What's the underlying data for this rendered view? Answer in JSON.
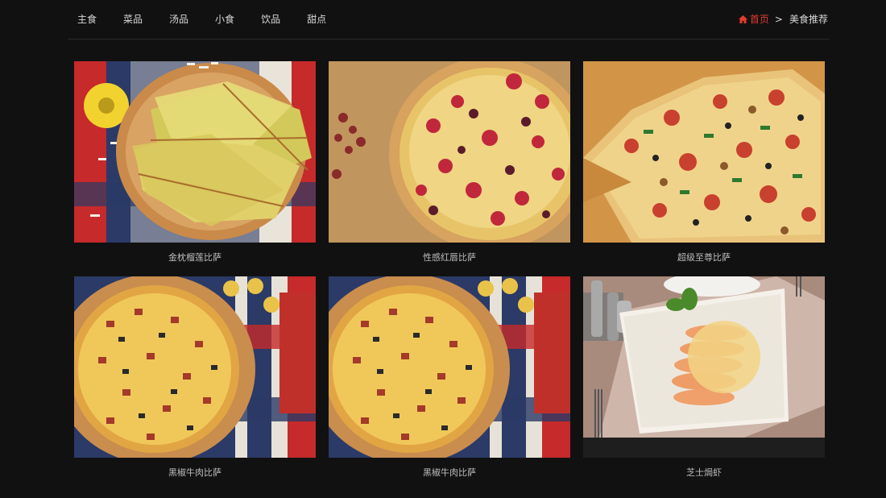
{
  "nav": {
    "items": [
      {
        "label": "主食"
      },
      {
        "label": "菜品"
      },
      {
        "label": "汤品"
      },
      {
        "label": "小食"
      },
      {
        "label": "饮品"
      },
      {
        "label": "甜点"
      }
    ]
  },
  "breadcrumb": {
    "home_label": "首页",
    "separator": ">",
    "current": "美食推荐",
    "home_icon": "home-icon",
    "home_color": "#e43b2e"
  },
  "products": [
    {
      "caption": "金枕榴莲比萨",
      "image": "durian-pizza-slices"
    },
    {
      "caption": "性感红唇比萨",
      "image": "cranberry-pizza"
    },
    {
      "caption": "超级至尊比萨",
      "image": "supreme-pizza"
    },
    {
      "caption": "黑椒牛肉比萨",
      "image": "pepper-beef-pizza"
    },
    {
      "caption": "黑椒牛肉比萨",
      "image": "pepper-beef-pizza"
    },
    {
      "caption": "芝士焗虾",
      "image": "cheese-baked-shrimp"
    }
  ]
}
